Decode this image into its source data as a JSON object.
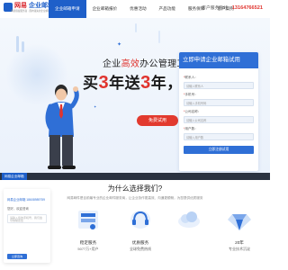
{
  "header": {
    "logo_red": "网易",
    "logo_blue": "企业邮箱",
    "logo_sub": "网易授权服务商 · 国内领先的企业邮箱服务商",
    "nav": [
      "企业邮箱申请",
      "企业邮箱报价",
      "优惠活动",
      "产品功能",
      "服务保障",
      "客户案例"
    ],
    "phone_label": "客户服务热线：",
    "phone": "13164766521"
  },
  "hero": {
    "title1_pre": "企业",
    "title1_hl": "高效",
    "title1_post": "办公管理工具",
    "title2_a": "买",
    "title2_n1": "3",
    "title2_b": "年送",
    "title2_n2": "3",
    "title2_c": "年，多买多送",
    "button": "免费试用"
  },
  "form": {
    "title": "立即申请企业邮箱试用",
    "fields": [
      {
        "label": "联系人：",
        "placeholder": "请输入联系人"
      },
      {
        "label": "手机号：",
        "placeholder": "请输入手机号码"
      },
      {
        "label": "公司名称：",
        "placeholder": "请输入公司名称"
      },
      {
        "label": "用户数：",
        "placeholder": "请输入用户数"
      }
    ],
    "submit": "立即注册试用"
  },
  "strip": {
    "badge": "网易企业邮箱"
  },
  "why": {
    "title": "为什么选择我们?",
    "sub": "网易邮件是目前最专业的企业邮件服务商，让企业协作更高效、沟通更顺畅，为您提供优质服务"
  },
  "mini_card": {
    "line1": "网易企业邮箱 18608989759",
    "line2": "您好，欢迎咨询",
    "input_placeholder": "请输入您的手机号，我们会尽快联系您",
    "button": "立即咨询"
  },
  "features": [
    {
      "t1": "稳定服务",
      "t2": "5077万+用户"
    },
    {
      "t1": "优质服务",
      "t2": "全球免费热线"
    },
    {
      "t1": "",
      "t2": ""
    },
    {
      "t1": "20年",
      "t2": "专业技术沉淀"
    }
  ],
  "colors": {
    "primary": "#2f6fd6",
    "accent_red": "#e0342e",
    "nav_active": "#1e5fc9"
  }
}
